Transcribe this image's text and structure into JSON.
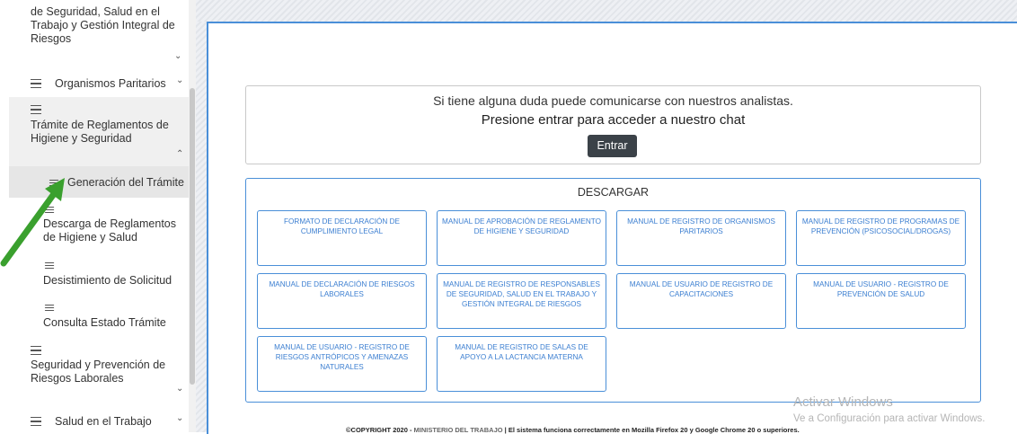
{
  "sidebar": {
    "items": [
      {
        "label_lines": [
          "de Seguridad, Salud en el",
          "Trabajo y Gestión Integral de",
          "Riesgos"
        ]
      },
      {
        "label": "Organismos Paritarios"
      },
      {
        "label_lines": [
          "Trámite de Reglamentos de",
          "Higiene y Seguridad"
        ]
      },
      {
        "label": "Generación del Trámite"
      },
      {
        "label_lines": [
          "Descarga de Reglamentos",
          "de Higiene y Salud"
        ]
      },
      {
        "label": "Desistimiento de Solicitud"
      },
      {
        "label": "Consulta Estado Trámite"
      },
      {
        "label_lines": [
          "Seguridad y Prevención de",
          "Riesgos Laborales"
        ]
      },
      {
        "label": "Salud en el Trabajo"
      }
    ]
  },
  "chat": {
    "line1": "Si tiene alguna duda puede comunicarse con nuestros analistas.",
    "line2": "Presione entrar para acceder a nuestro chat",
    "button": "Entrar"
  },
  "downloads": {
    "title": "DESCARGAR",
    "buttons": [
      "FORMATO DE DECLARACIÓN DE CUMPLIMIENTO LEGAL",
      "MANUAL DE APROBACIÓN DE REGLAMENTO DE HIGIENE Y SEGURIDAD",
      "MANUAL DE REGISTRO DE ORGANISMOS PARITARIOS",
      "MANUAL DE REGISTRO DE PROGRAMAS DE PREVENCIÓN (PSICOSOCIAL/DROGAS)",
      "MANUAL DE DECLARACIÓN DE RIESGOS LABORALES",
      "MANUAL DE REGISTRO DE RESPONSABLES DE SEGURIDAD, SALUD EN EL TRABAJO Y GESTIÓN INTEGRAL DE RIESGOS",
      "MANUAL DE USUARIO DE REGISTRO DE CAPACITACIONES",
      "MANUAL DE USUARIO - REGISTRO DE PREVENCIÓN DE SALUD",
      "MANUAL DE USUARIO - REGISTRO DE RIESGOS ANTRÓPICOS Y AMENAZAS NATURALES",
      "MANUAL DE REGISTRO DE SALAS DE APOYO A LA LACTANCIA MATERNA"
    ]
  },
  "footer": {
    "copyright": "©COPYRIGHT 2020 - ",
    "org": "MINISTERIO DEL TRABAJO",
    "note": " | El sistema funciona correctamente en Mozilla Firefox 20 y Google Chrome 20 o superiores."
  },
  "watermark": {
    "line1": "Activar Windows",
    "line2": "Ve a Configuración para activar Windows."
  },
  "colors": {
    "accent": "#4a8fd8",
    "link": "#3c7fd1",
    "button_dark": "#3b4248",
    "arrow": "#3aa02e"
  }
}
